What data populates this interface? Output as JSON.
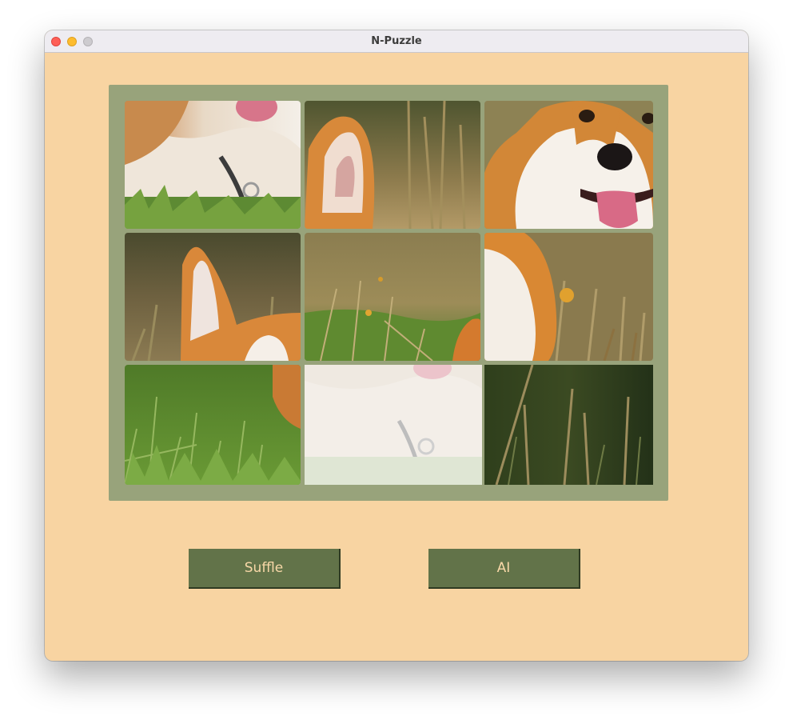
{
  "window": {
    "title": "N-Puzzle"
  },
  "puzzle": {
    "tiles": [
      {
        "id": "corgi-chest-tongue",
        "blank": false
      },
      {
        "id": "corgi-ear-right",
        "blank": false
      },
      {
        "id": "corgi-face",
        "blank": false
      },
      {
        "id": "corgi-ear-left",
        "blank": false
      },
      {
        "id": "grass-field",
        "blank": false
      },
      {
        "id": "corgi-cheek",
        "blank": false
      },
      {
        "id": "grass-foreground",
        "blank": false
      },
      {
        "id": "corgi-chest-faded",
        "blank": true
      },
      {
        "id": "dark-grass",
        "blank": false
      }
    ]
  },
  "controls": {
    "shuffle_label": "Suffle",
    "ai_label": "AI"
  }
}
